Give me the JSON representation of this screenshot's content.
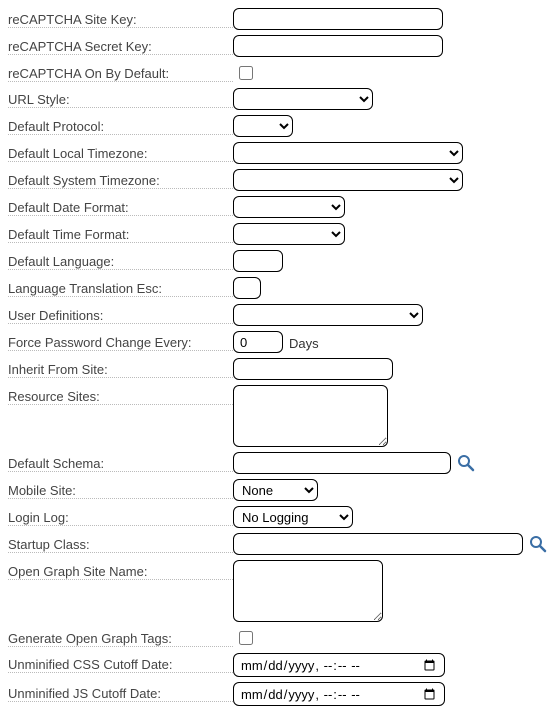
{
  "fields": {
    "recaptcha_site_key": {
      "label": "reCAPTCHA Site Key:",
      "value": ""
    },
    "recaptcha_secret_key": {
      "label": "reCAPTCHA Secret Key:",
      "value": ""
    },
    "recaptcha_on_default": {
      "label": "reCAPTCHA On By Default:",
      "checked": false
    },
    "url_style": {
      "label": "URL Style:",
      "selected": ""
    },
    "default_protocol": {
      "label": "Default Protocol:",
      "selected": ""
    },
    "default_local_tz": {
      "label": "Default Local Timezone:",
      "selected": ""
    },
    "default_system_tz": {
      "label": "Default System Timezone:",
      "selected": ""
    },
    "default_date_format": {
      "label": "Default Date Format:",
      "selected": ""
    },
    "default_time_format": {
      "label": "Default Time Format:",
      "selected": ""
    },
    "default_language": {
      "label": "Default Language:",
      "value": ""
    },
    "lang_translation_esc": {
      "label": "Language Translation Esc:",
      "value": ""
    },
    "user_definitions": {
      "label": "User Definitions:",
      "selected": ""
    },
    "force_pw_change": {
      "label": "Force Password Change Every:",
      "value": "0",
      "suffix": "Days"
    },
    "inherit_from_site": {
      "label": "Inherit From Site:",
      "value": ""
    },
    "resource_sites": {
      "label": "Resource Sites:",
      "value": ""
    },
    "default_schema": {
      "label": "Default Schema:",
      "value": ""
    },
    "mobile_site": {
      "label": "Mobile Site:",
      "selected": "None"
    },
    "login_log": {
      "label": "Login Log:",
      "selected": "No Logging"
    },
    "startup_class": {
      "label": "Startup Class:",
      "value": ""
    },
    "og_site_name": {
      "label": "Open Graph Site Name:",
      "value": ""
    },
    "generate_og_tags": {
      "label": "Generate Open Graph Tags:",
      "checked": false
    },
    "unminified_css_cutoff": {
      "label": "Unminified CSS Cutoff Date:",
      "placeholder": "mm/dd/yyyy --:-- --"
    },
    "unminified_js_cutoff": {
      "label": "Unminified JS Cutoff Date:",
      "placeholder": "mm/dd/yyyy --:-- --"
    }
  }
}
